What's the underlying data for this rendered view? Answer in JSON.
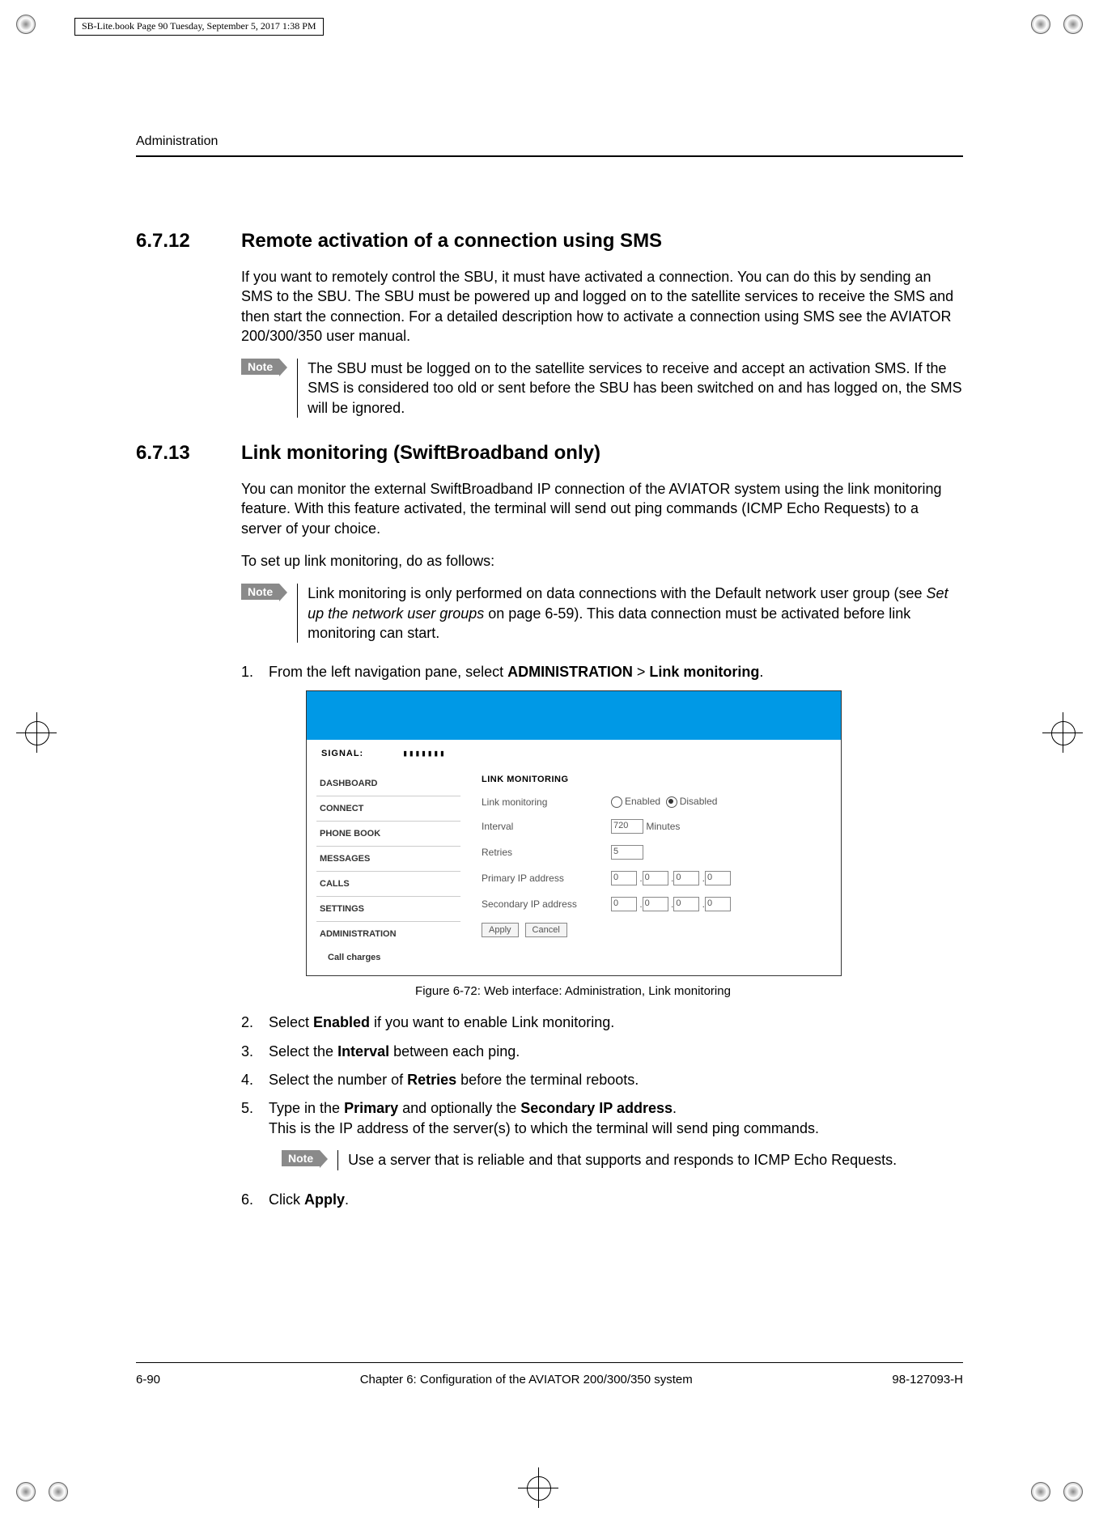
{
  "meta": {
    "frame_maker_header": "SB-Lite.book  Page 90  Tuesday, September 5, 2017  1:38 PM"
  },
  "running_head": "Administration",
  "sections": {
    "s1": {
      "num": "6.7.12",
      "title": "Remote activation of a connection using SMS"
    },
    "s2": {
      "num": "6.7.13",
      "title": "Link monitoring (SwiftBroadband only)"
    }
  },
  "paras": {
    "p1": "If you want to remotely control the SBU, it must have activated a connection. You can do this by sending an SMS to the SBU. The SBU must be powered up and logged on to the satellite services to receive the SMS and then start the connection. For a detailed description how to activate a connection using SMS see the AVIATOR 200/300/350 user manual.",
    "p2": "You can monitor the external SwiftBroadband IP connection of the AVIATOR system using the link monitoring feature. With this feature activated, the terminal will send out ping commands (ICMP Echo Requests) to a server of your choice.",
    "p3": "To set up link monitoring, do as follows:"
  },
  "notes": {
    "label": "Note",
    "n1": "The SBU must be logged on to the satellite services to receive and accept an activation SMS. If the SMS is considered too old or sent before the SBU has been switched on and has logged on, the SMS will be ignored.",
    "n2_pre": "Link monitoring is only performed on data connections with the Default network user group (see ",
    "n2_em": "Set up the network user groups",
    "n2_post": " on page 6-59). This data connection must be activated before link monitoring can start.",
    "n3": "Use a server that is reliable and that supports and responds to ICMP Echo Requests."
  },
  "steps": {
    "s1_pre": "From the left navigation pane, select ",
    "s1_b1": "ADMINISTRATION",
    "s1_mid": " > ",
    "s1_b2": "Link monitoring",
    "s1_post": ".",
    "s2_pre": "Select ",
    "s2_b": "Enabled",
    "s2_post": " if you want to enable Link monitoring.",
    "s3_pre": "Select the ",
    "s3_b": "Interval",
    "s3_post": " between each ping.",
    "s4_pre": "Select the number of ",
    "s4_b": "Retries",
    "s4_post": " before the terminal reboots.",
    "s5_pre": "Type in the ",
    "s5_b1": "Primary",
    "s5_mid": " and optionally the ",
    "s5_b2": "Secondary IP address",
    "s5_post": ".",
    "s5_line2": "This is the IP address of the server(s) to which the terminal will send ping commands.",
    "s6_pre": "Click ",
    "s6_b": "Apply",
    "s6_post": "."
  },
  "figure": {
    "signal_label": "SIGNAL:",
    "signal_bars": "▮▮▮▮▮▮▮",
    "nav": [
      "DASHBOARD",
      "CONNECT",
      "PHONE BOOK",
      "MESSAGES",
      "CALLS",
      "SETTINGS",
      "ADMINISTRATION"
    ],
    "nav_sub": "Call charges",
    "heading": "LINK MONITORING",
    "row_lm": "Link monitoring",
    "opt_enabled": "Enabled",
    "opt_disabled": "Disabled",
    "row_interval": "Interval",
    "interval_val": "720",
    "interval_unit": "Minutes",
    "row_retries": "Retries",
    "retries_val": "5",
    "row_pip": "Primary IP address",
    "row_sip": "Secondary IP address",
    "ip_octet": "0",
    "btn_apply": "Apply",
    "btn_cancel": "Cancel",
    "caption": "Figure 6-72: Web interface: Administration, Link monitoring"
  },
  "footer": {
    "page": "6-90",
    "chapter": "Chapter 6:  Configuration of the AVIATOR 200/300/350 system",
    "docnum": "98-127093-H"
  }
}
